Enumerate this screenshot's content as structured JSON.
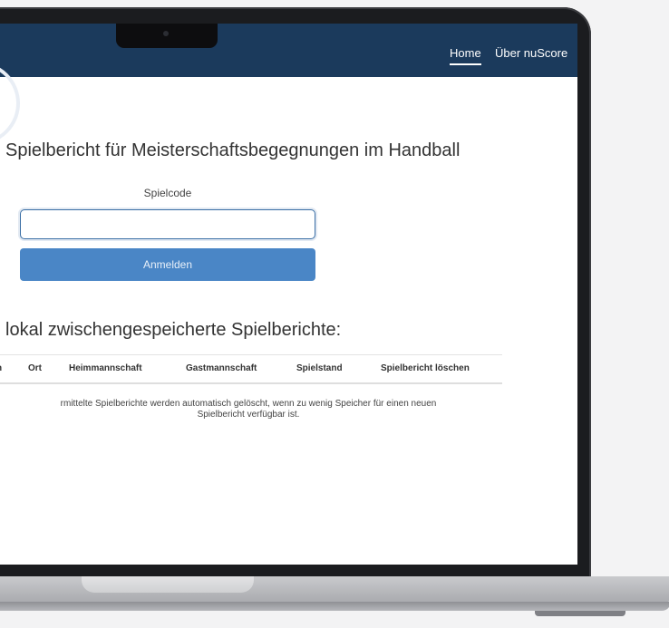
{
  "nav": {
    "home": "Home",
    "about": "Über nuScore"
  },
  "main": {
    "title": "Spielbericht für Meisterschaftsbegegnungen im Handball",
    "code_label": "Spielcode",
    "code_value": "",
    "login_button": "Anmelden"
  },
  "saved": {
    "title": "lokal zwischengespeicherte Spielberichte:",
    "columns": [
      "n",
      "Ort",
      "Heimmannschaft",
      "Gastmannschaft",
      "Spielstand",
      "Spielbericht löschen"
    ],
    "note_line1": "rmittelte Spielberichte werden automatisch gelöscht, wenn zu wenig Speicher für einen neuen",
    "note_line2": "Spielbericht verfügbar ist."
  },
  "colors": {
    "navbar": "#1b3a5c",
    "button": "#4a86c6",
    "input_border": "#3a6ea5"
  }
}
